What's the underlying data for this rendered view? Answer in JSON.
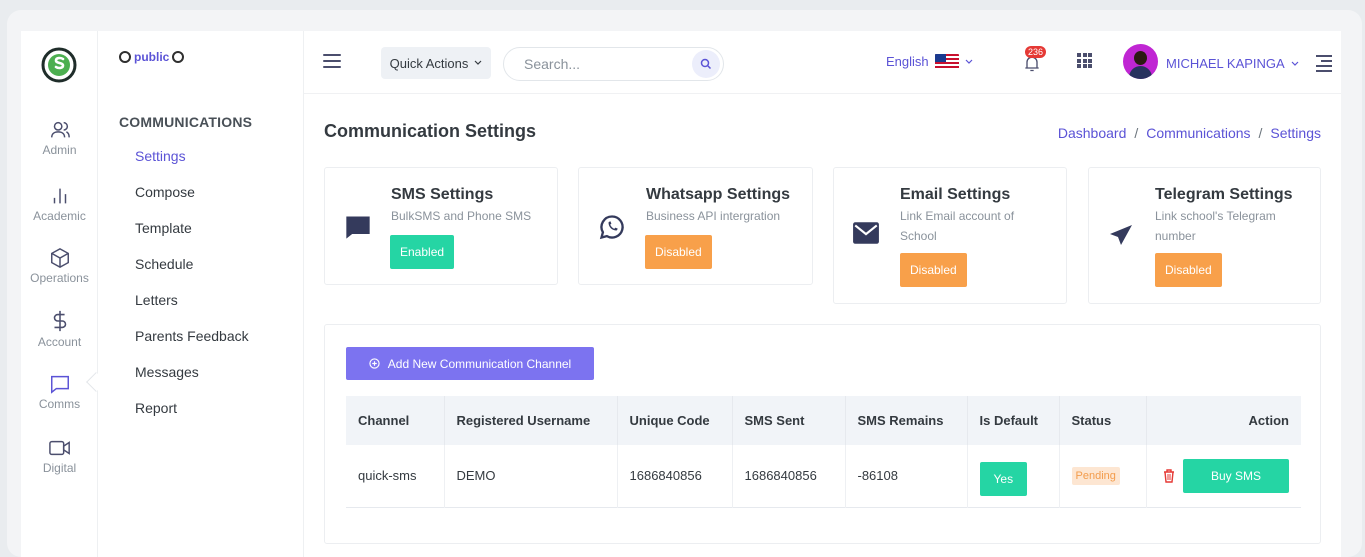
{
  "rail": {
    "items": [
      {
        "label": "Admin",
        "icon": "users-icon"
      },
      {
        "label": "Academic",
        "icon": "bar-chart-icon"
      },
      {
        "label": "Operations",
        "icon": "box-icon"
      },
      {
        "label": "Account",
        "icon": "dollar-icon"
      },
      {
        "label": "Comms",
        "icon": "message-square-icon"
      },
      {
        "label": "Digital",
        "icon": "video-icon"
      }
    ]
  },
  "subnav": {
    "brand": "public",
    "title": "COMMUNICATIONS",
    "items": [
      "Settings",
      "Compose",
      "Template",
      "Schedule",
      "Letters",
      "Parents Feedback",
      "Messages",
      "Report"
    ],
    "active": "Settings"
  },
  "topbar": {
    "quick_actions": "Quick Actions",
    "search_placeholder": "Search...",
    "language": "English",
    "notifications": "236",
    "user_name": "MICHAEL KAPINGA"
  },
  "page": {
    "title": "Communication Settings",
    "breadcrumb": [
      "Dashboard",
      "Communications",
      "Settings"
    ]
  },
  "cards": [
    {
      "title": "SMS Settings",
      "desc": "BulkSMS and Phone SMS",
      "status": "Enabled",
      "icon": "chat-bubble-icon"
    },
    {
      "title": "Whatsapp Settings",
      "desc": "Business API intergration",
      "status": "Disabled",
      "icon": "whatsapp-icon"
    },
    {
      "title": "Email Settings",
      "desc": "Link Email account of School",
      "status": "Disabled",
      "icon": "envelope-icon"
    },
    {
      "title": "Telegram Settings",
      "desc": "Link school's Telegram number",
      "status": "Disabled",
      "icon": "paper-plane-icon"
    }
  ],
  "panel": {
    "add_button": "Add New Communication Channel",
    "columns": [
      "Channel",
      "Registered Username",
      "Unique Code",
      "SMS Sent",
      "SMS Remains",
      "Is Default",
      "Status",
      "Action"
    ],
    "rows": [
      {
        "channel": "quick-sms",
        "username": "DEMO",
        "code": "1686840856",
        "sent": "1686840856",
        "remains": "-86108",
        "is_default": "Yes",
        "status": "Pending",
        "action": "Buy SMS"
      }
    ]
  },
  "colors": {
    "accent": "#5b53d6",
    "success": "#25d5a4",
    "warning": "#f8a04a",
    "button": "#7c73f0"
  }
}
